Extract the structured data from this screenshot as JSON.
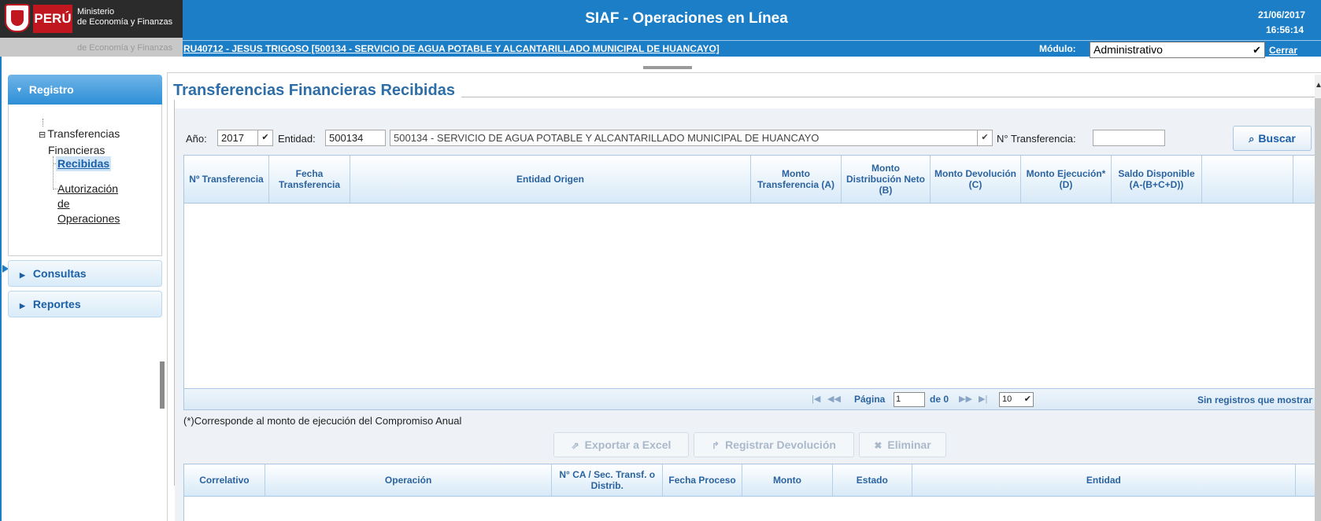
{
  "header": {
    "logo_country": "PERÚ",
    "logo_ministry_line1": "Ministerio",
    "logo_ministry_line2": "de Economía y Finanzas",
    "logo_ghost": "de Economía y Finanzas",
    "app_title": "SIAF - Operaciones en Línea",
    "user_info": "RU40712  - JESUS TRIGOSO [500134 - SERVICIO DE AGUA POTABLE Y ALCANTARILLADO MUNICIPAL DE HUANCAYO]",
    "date": "21/06/2017",
    "time": "16:56:14",
    "modulo_label": "Módulo:",
    "modulo_value": "Administrativo",
    "logout_label": "Cerrar sesión"
  },
  "sidebar": {
    "registro_label": "Registro",
    "tree_parent_line1": "Transferencias",
    "tree_parent_line2": "Financieras",
    "recibidas": "Recibidas",
    "autorizacion_line1": "Autorización",
    "autorizacion_line2": "de",
    "autorizacion_line3": "Operaciones",
    "consultas_label": "Consultas",
    "reportes_label": "Reportes"
  },
  "page": {
    "title": "Transferencias Financieras Recibidas"
  },
  "filters": {
    "anio_label": "Año:",
    "anio_value": "2017",
    "entidad_label": "Entidad:",
    "entidad_code": "500134",
    "entidad_name": "500134 - SERVICIO DE AGUA POTABLE Y ALCANTARILLADO MUNICIPAL DE HUANCAYO",
    "transferencia_label": "N° Transferencia:",
    "transferencia_value": "",
    "buscar_label": "Buscar"
  },
  "grid1": {
    "columns": [
      "Nº Transferencia",
      "Fecha Transferencia",
      "Entidad Origen",
      "Monto Transferencia (A)",
      "Monto Distribución Neto (B)",
      "Monto Devolución (C)",
      "Monto Ejecución* (D)",
      "Saldo Disponible (A-(B+C+D))",
      ""
    ],
    "rows": []
  },
  "pager": {
    "page_label": "Página",
    "page_value": "1",
    "of_label": "de 0",
    "page_size": "10",
    "no_records": "Sin registros que mostrar"
  },
  "note": "(*)Corresponde al monto de ejecución del Compromiso Anual",
  "actions": {
    "export_label": "Exportar a Excel",
    "register_label": "Registrar Devolución",
    "delete_label": "Eliminar"
  },
  "grid2": {
    "columns": [
      "Correlativo",
      "Operación",
      "N° CA / Sec. Transf. o Distrib.",
      "Fecha Proceso",
      "Monto",
      "Estado",
      "Entidad",
      ""
    ],
    "rows": []
  },
  "colors": {
    "header_blue": "#1b7ec7",
    "title_blue": "#2d6ea8",
    "grid_header_text": "#2a63a0"
  }
}
